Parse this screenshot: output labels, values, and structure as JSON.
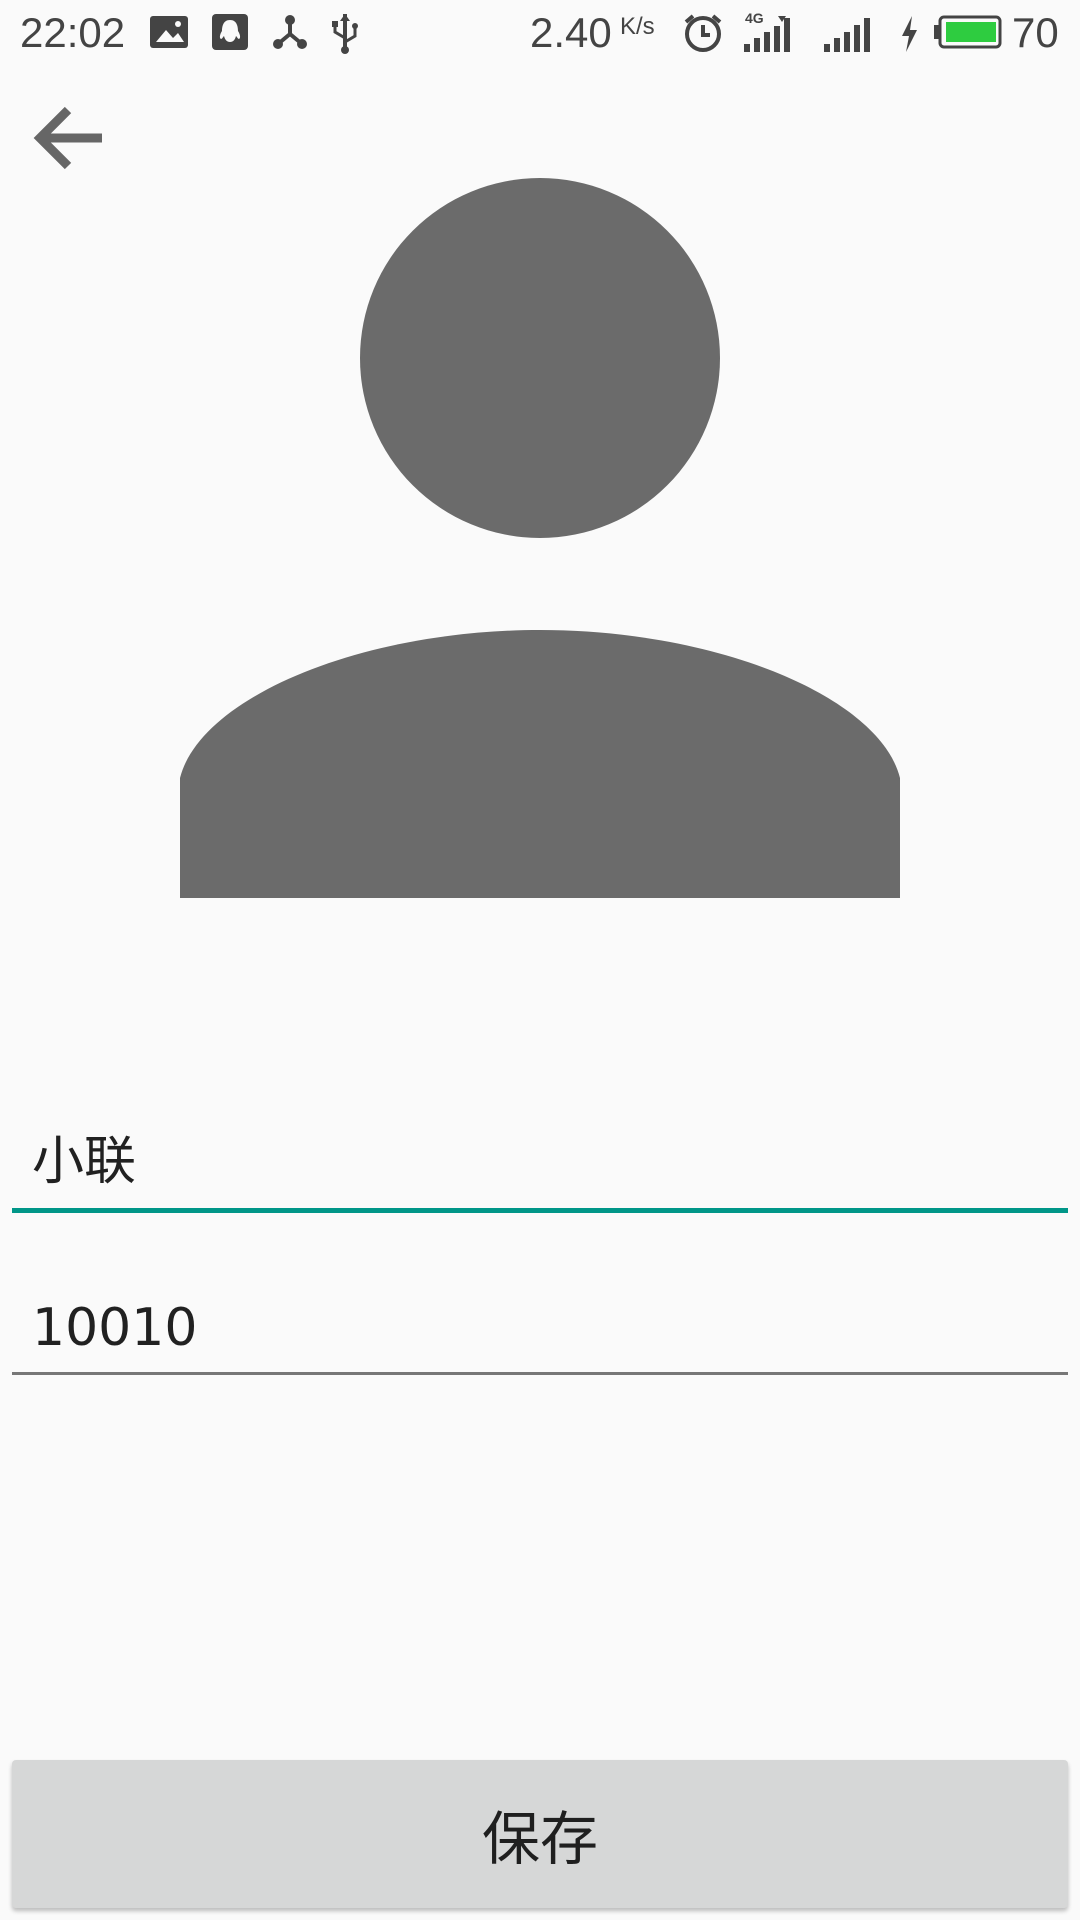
{
  "status_bar": {
    "time": "22:02",
    "net_speed": "2.40",
    "net_speed_unit": "K/s",
    "network_type": "4G",
    "battery_percent": "70",
    "battery_color": "#2ecc40",
    "icons": [
      "image-icon",
      "qq-icon",
      "share-icon",
      "usb-icon",
      "alarm-icon",
      "signal-icon",
      "signal-icon",
      "charging-icon",
      "battery-icon"
    ]
  },
  "header": {
    "back_icon": "arrow-left-icon"
  },
  "avatar": {
    "icon": "person-icon",
    "color": "#6b6b6b"
  },
  "form": {
    "name_value": "小联",
    "phone_value": "10010",
    "accent_color": "#009688"
  },
  "save_label": "保存"
}
